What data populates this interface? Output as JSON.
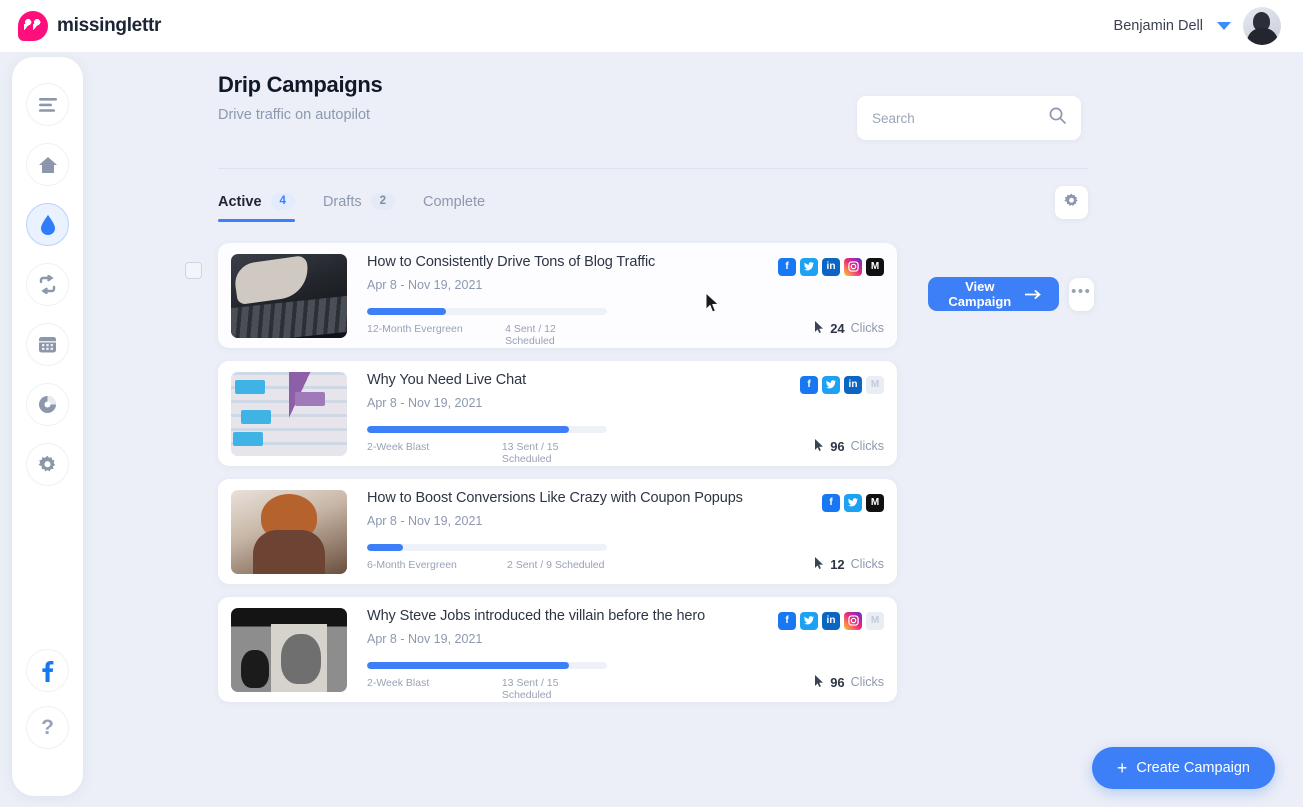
{
  "brand": {
    "name": "missinglettr",
    "logo_icon": "quote-bubble-icon",
    "color": "#ff0f7b"
  },
  "header": {
    "user_name": "Benjamin Dell",
    "caret_icon": "chevron-down-icon",
    "avatar_icon": "user-avatar"
  },
  "sidebar": {
    "items": [
      {
        "name": "menu",
        "icon": "hamburger-menu-icon",
        "active": false
      },
      {
        "name": "home",
        "icon": "home-icon",
        "active": false
      },
      {
        "name": "drip-campaigns",
        "icon": "water-drop-icon",
        "active": true
      },
      {
        "name": "curate",
        "icon": "repost-refresh-icon",
        "active": false
      },
      {
        "name": "calendar",
        "icon": "calendar-icon",
        "active": false
      },
      {
        "name": "analytics",
        "icon": "pie-chart-icon",
        "active": false
      },
      {
        "name": "settings",
        "icon": "gear-icon",
        "active": false
      }
    ],
    "bottom": [
      {
        "name": "facebook",
        "icon": "facebook-icon",
        "label": "f"
      },
      {
        "name": "help",
        "icon": "question-mark-icon",
        "label": "?"
      }
    ]
  },
  "page": {
    "title": "Drip Campaigns",
    "subtitle": "Drive traffic on autopilot",
    "settings_icon": "gear-icon"
  },
  "search": {
    "placeholder": "Search",
    "value": "",
    "icon": "search-icon"
  },
  "tabs": [
    {
      "label": "Active",
      "badge": "4",
      "active": true
    },
    {
      "label": "Drafts",
      "badge": "2",
      "active": false
    },
    {
      "label": "Complete",
      "badge": "",
      "active": false
    }
  ],
  "actions": {
    "view_campaign_label": "View Campaign",
    "view_campaign_arrow": "arrow-right-icon",
    "more_label": "•••",
    "create_campaign_label": "Create Campaign",
    "create_plus": "+"
  },
  "campaigns": [
    {
      "title": "How to Consistently Drive Tons of Blog Traffic",
      "dates": "Apr 8 - Nov 19, 2021",
      "progress_percent": 33,
      "plan": "12-Month Evergreen",
      "sent_scheduled": "4 Sent / 12 Scheduled",
      "clicks_count": "24",
      "clicks_label": "Clicks",
      "socials": [
        {
          "name": "facebook",
          "enabled": true
        },
        {
          "name": "twitter",
          "enabled": true
        },
        {
          "name": "linkedin",
          "enabled": true
        },
        {
          "name": "instagram",
          "enabled": true
        },
        {
          "name": "medium",
          "enabled": true
        }
      ],
      "selected": false,
      "hovered": true
    },
    {
      "title": "Why You Need Live Chat",
      "dates": "Apr 8 - Nov 19, 2021",
      "progress_percent": 84,
      "plan": "2-Week Blast",
      "sent_scheduled": "13 Sent / 15 Scheduled",
      "clicks_count": "96",
      "clicks_label": "Clicks",
      "socials": [
        {
          "name": "facebook",
          "enabled": true
        },
        {
          "name": "twitter",
          "enabled": true
        },
        {
          "name": "linkedin",
          "enabled": true
        },
        {
          "name": "medium",
          "enabled": false
        }
      ],
      "selected": false,
      "hovered": false
    },
    {
      "title": "How to Boost Conversions Like Crazy with Coupon Popups",
      "dates": "Apr 8 - Nov 19, 2021",
      "progress_percent": 15,
      "plan": "6-Month Evergreen",
      "sent_scheduled": "2 Sent / 9 Scheduled",
      "clicks_count": "12",
      "clicks_label": "Clicks",
      "socials": [
        {
          "name": "facebook",
          "enabled": true
        },
        {
          "name": "twitter",
          "enabled": true
        },
        {
          "name": "medium",
          "enabled": true
        }
      ],
      "selected": false,
      "hovered": false
    },
    {
      "title": "Why Steve Jobs introduced the villain before the hero",
      "dates": "Apr 8 - Nov 19, 2021",
      "progress_percent": 84,
      "plan": "2-Week Blast",
      "sent_scheduled": "13 Sent / 15 Scheduled",
      "clicks_count": "96",
      "clicks_label": "Clicks",
      "socials": [
        {
          "name": "facebook",
          "enabled": true
        },
        {
          "name": "twitter",
          "enabled": true
        },
        {
          "name": "linkedin",
          "enabled": true
        },
        {
          "name": "instagram",
          "enabled": true
        },
        {
          "name": "medium",
          "enabled": false
        }
      ],
      "selected": false,
      "hovered": false
    }
  ],
  "colors": {
    "accent": "#3d7ff6",
    "brand": "#ff0f7b",
    "page_bg": "#eceff7",
    "card_bg": "#ffffff",
    "muted_text": "#8d98ae"
  }
}
